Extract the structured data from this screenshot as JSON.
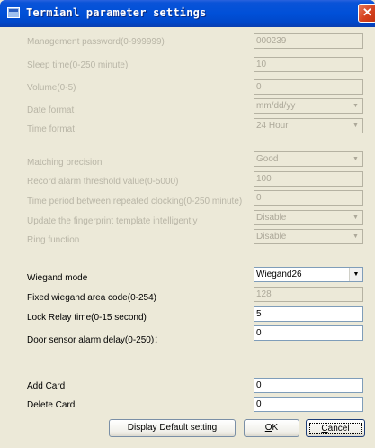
{
  "window": {
    "title": "Termianl parameter settings",
    "close_glyph": "✕"
  },
  "rows": {
    "management_password": {
      "label": "Management password(0-999999)",
      "value": "000239"
    },
    "sleep_time": {
      "label": "Sleep time(0-250 minute)",
      "value": "10"
    },
    "volume": {
      "label": "Volume(0-5)",
      "value": "0"
    },
    "date_format": {
      "label": "Date format",
      "value": "mm/dd/yy"
    },
    "time_format": {
      "label": "Time format",
      "value": "24 Hour"
    },
    "matching_precision": {
      "label": "Matching precision",
      "value": "Good"
    },
    "record_alarm_threshold": {
      "label": "Record alarm threshold value(0-5000)",
      "value": "100"
    },
    "repeat_clocking_period": {
      "label": "Time period between repeated clocking(0-250 minute)",
      "value": "0"
    },
    "update_fingerprint_template": {
      "label": "Update the fingerprint template intelligently",
      "value": "Disable"
    },
    "ring_function": {
      "label": "Ring function",
      "value": "Disable"
    },
    "wiegand_mode": {
      "label": "Wiegand mode",
      "value": "Wiegand26"
    },
    "fixed_wiegand_area_code": {
      "label": "Fixed wiegand area code(0-254)",
      "value": "128"
    },
    "lock_relay_time": {
      "label": "Lock Relay time(0-15 second)",
      "value": "5"
    },
    "door_sensor_alarm_delay": {
      "label": "Door sensor alarm delay(0-250)：",
      "value": "0"
    },
    "add_card": {
      "label": "Add Card",
      "value": "0"
    },
    "delete_card": {
      "label": "Delete Card",
      "value": "0"
    }
  },
  "buttons": {
    "display_default": "Display Default setting",
    "ok_mnemonic": "O",
    "ok_rest": "K",
    "cancel_mnemonic": "C",
    "cancel_rest": "ancel"
  },
  "icons": {
    "app": "window-app-icon",
    "close": "close-icon",
    "dropdown": "chevron-down-icon"
  },
  "colors": {
    "titlebar": "#0050d8",
    "dialog_bg": "#ece9d8",
    "disabled_text": "#b8b5a6",
    "close_button": "#d5421e"
  }
}
